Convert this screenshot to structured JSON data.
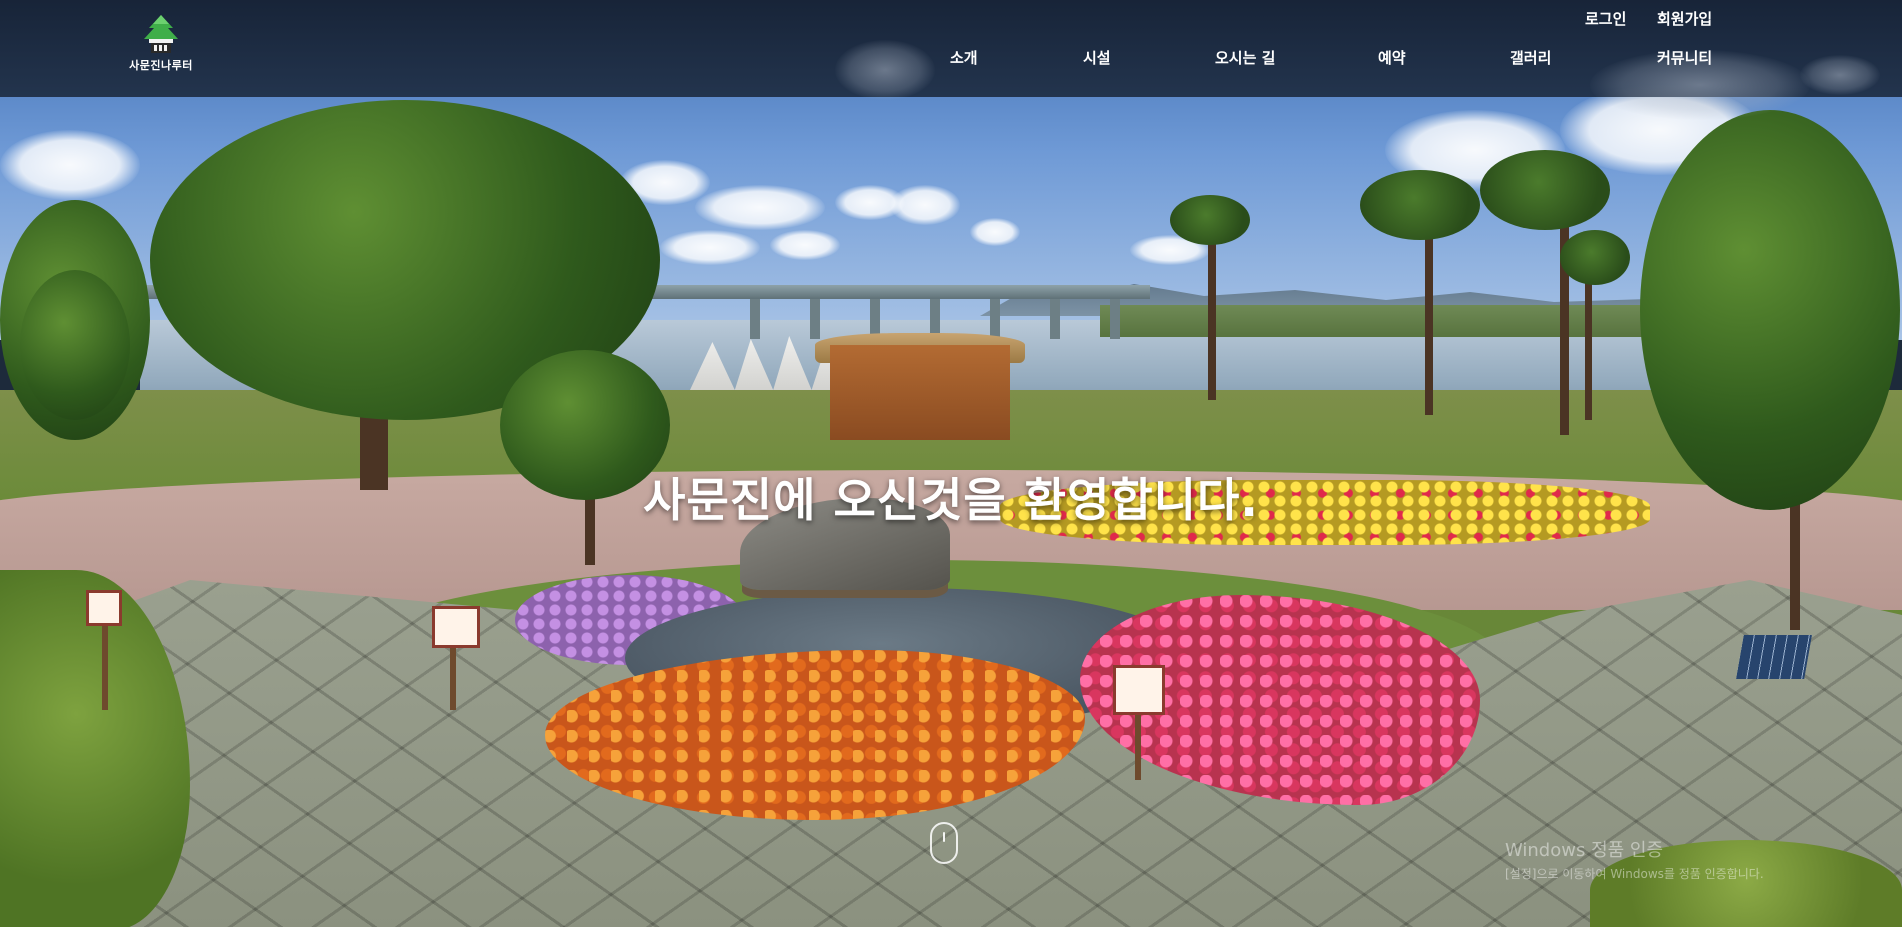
{
  "logo": {
    "text": "사문진나루터",
    "icon": "pine-tree-pavilion-icon"
  },
  "utility_nav": {
    "login": "로그인",
    "join": "회원가입"
  },
  "main_nav": {
    "items": [
      {
        "label": "소개"
      },
      {
        "label": "시설"
      },
      {
        "label": "오시는 길"
      },
      {
        "label": "예약"
      },
      {
        "label": "갤러리"
      },
      {
        "label": "커뮤니티"
      }
    ]
  },
  "hero": {
    "title": "사문진에 오신것을 환영합니다.",
    "scroll_icon": "mouse-scroll-icon"
  },
  "watermark": {
    "title": "Windows 정품 인증",
    "subtitle": "[설정]으로 이동하여 Windows를 정품 인증합니다."
  },
  "colors": {
    "header_bg": "#1e2d43",
    "nav_text": "#ffffff",
    "hero_text": "#ffffff"
  }
}
